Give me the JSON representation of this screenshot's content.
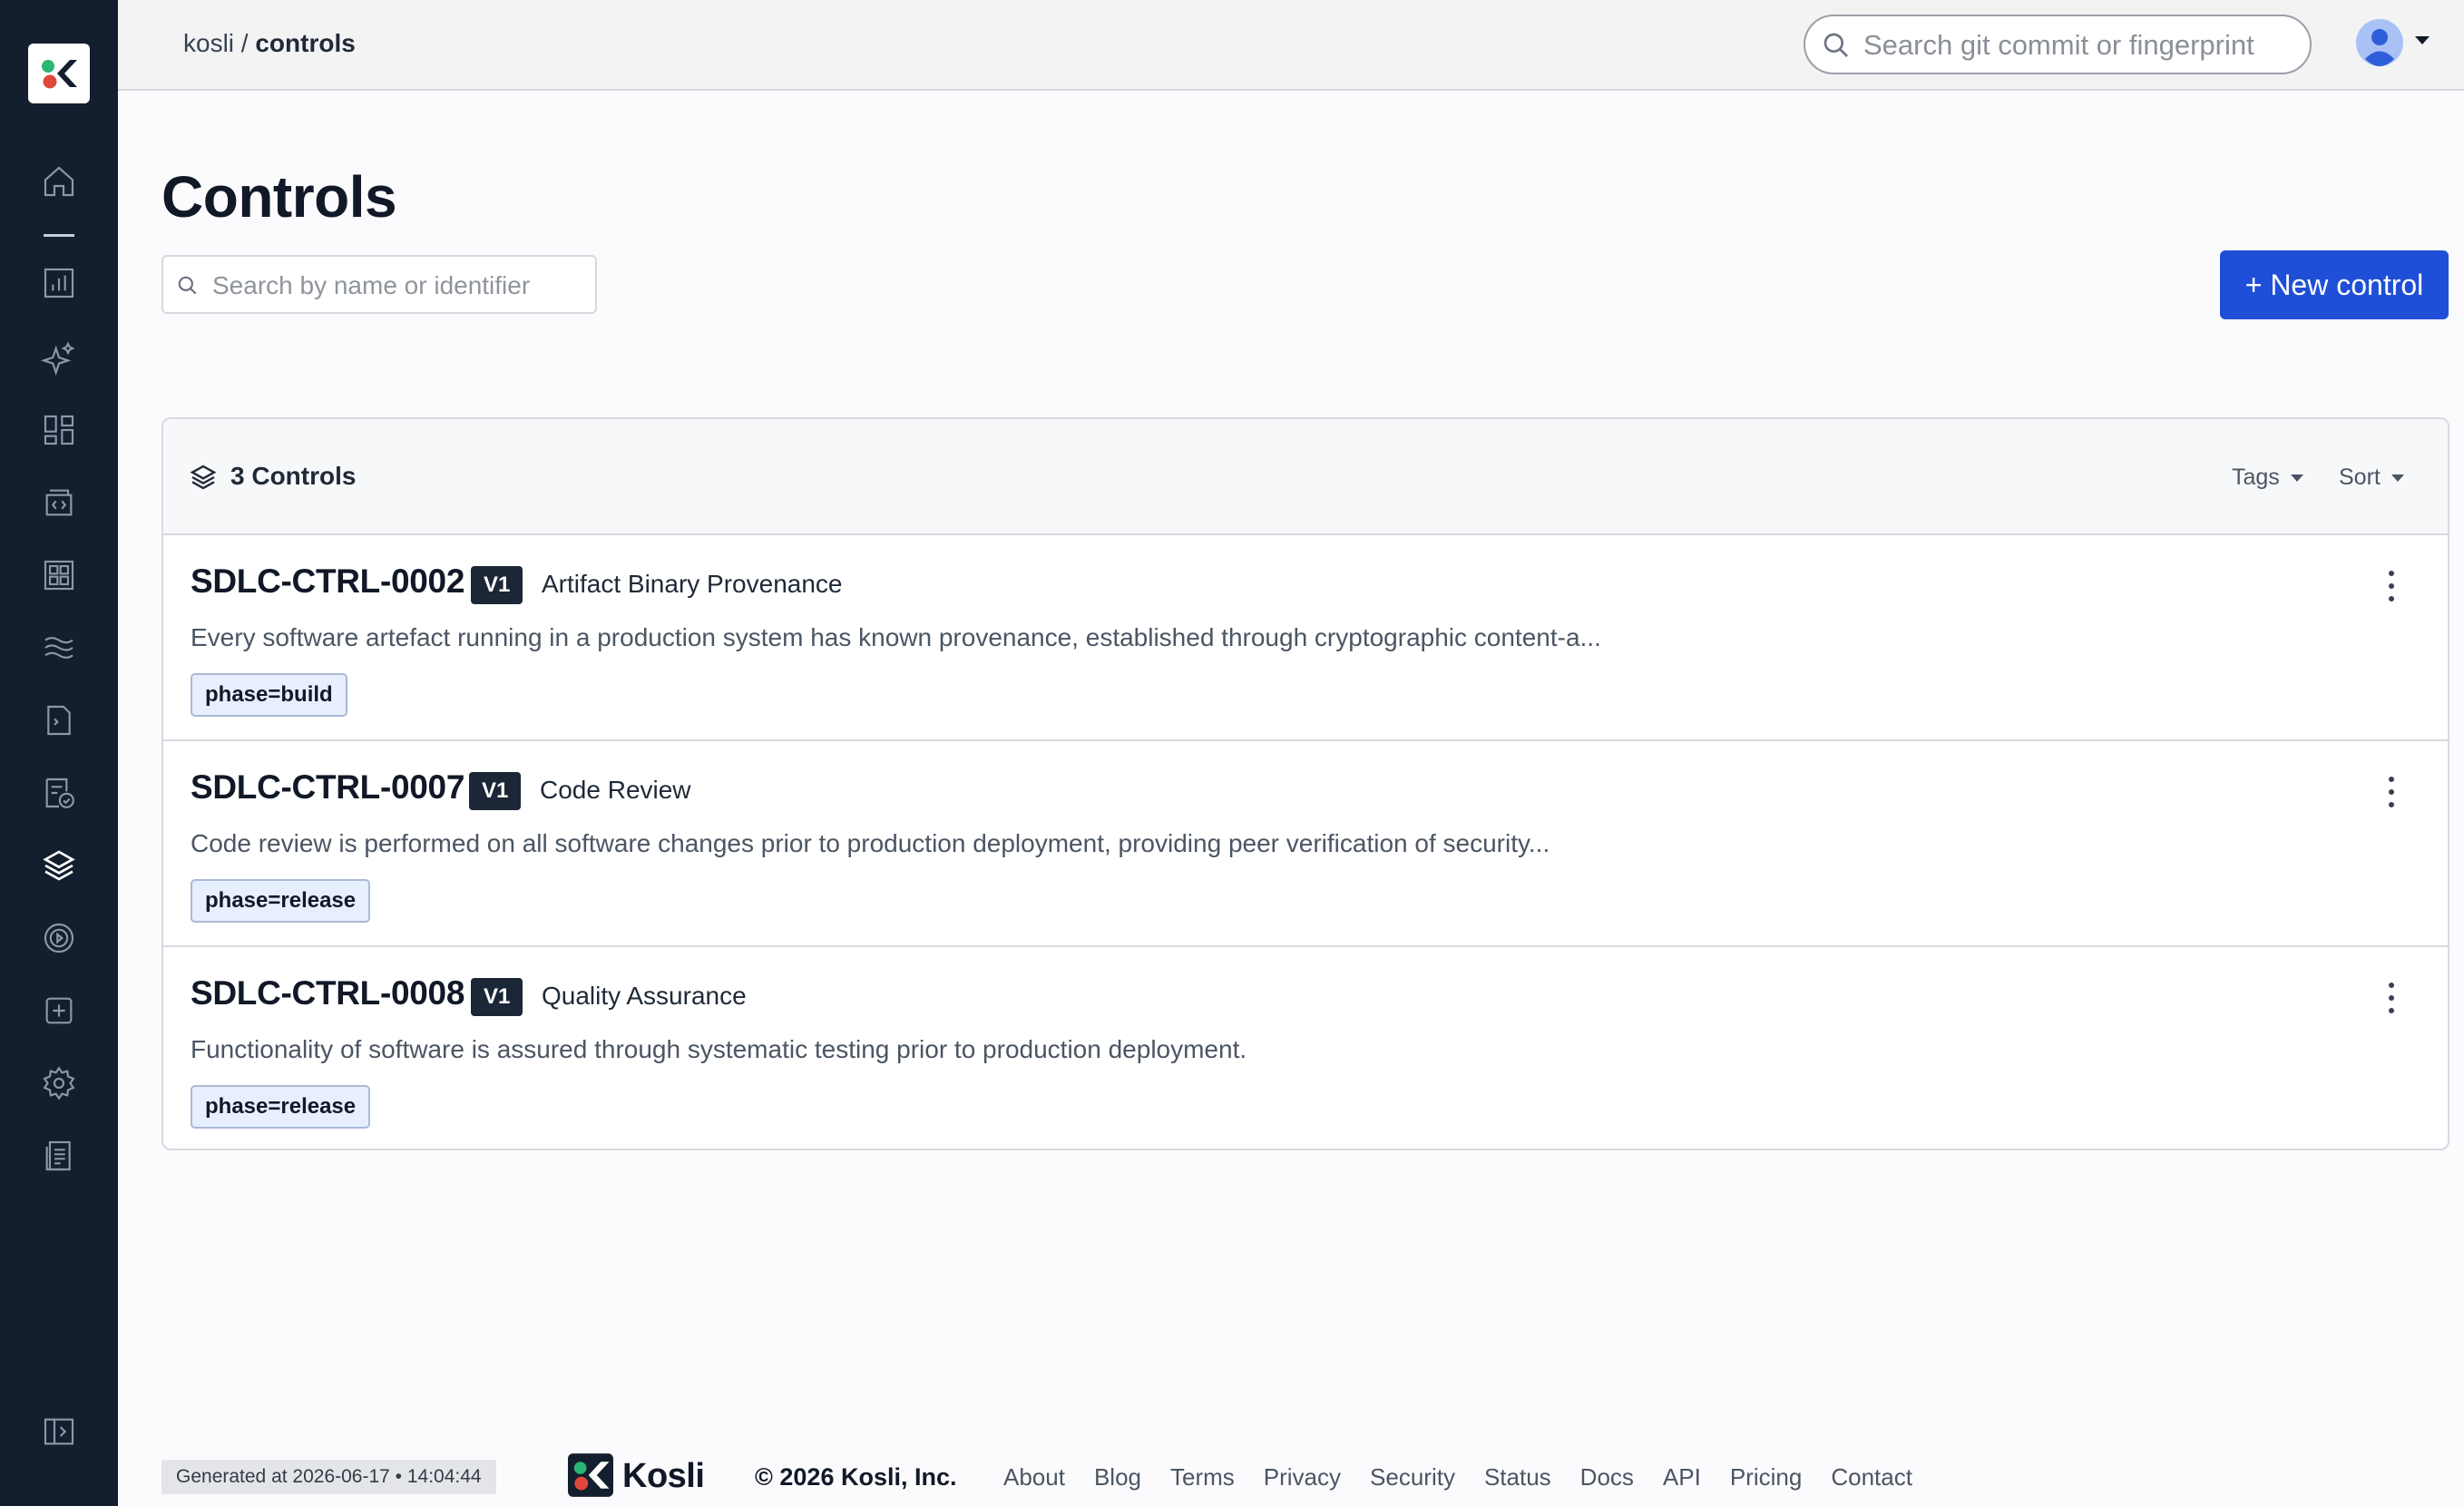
{
  "breadcrumb": {
    "org": "kosli",
    "separator": " / ",
    "current": "controls"
  },
  "global_search": {
    "placeholder": "Search git commit or fingerprint"
  },
  "page": {
    "title": "Controls",
    "search_placeholder": "Search by name or identifier",
    "new_button_label": "+ New control"
  },
  "panel": {
    "count_label": "3 Controls",
    "tags_label": "Tags",
    "sort_label": "Sort"
  },
  "controls": [
    {
      "id": "SDLC-CTRL-0002",
      "version": "V1",
      "name": "Artifact Binary Provenance",
      "description": "Every software artefact running in a production system has known provenance, established through cryptographic content-a...",
      "tag": "phase=build"
    },
    {
      "id": "SDLC-CTRL-0007",
      "version": "V1",
      "name": "Code Review",
      "description": "Code review is performed on all software changes prior to production deployment, providing peer verification of security...",
      "tag": "phase=release"
    },
    {
      "id": "SDLC-CTRL-0008",
      "version": "V1",
      "name": "Quality Assurance",
      "description": "Functionality of software is assured through systematic testing prior to production deployment.",
      "tag": "phase=release"
    }
  ],
  "footer": {
    "generated": "Generated at 2026-06-17 • 14:04:44",
    "brand": "Kosli",
    "copyright": "© 2026 Kosli, Inc.",
    "links": [
      "About",
      "Blog",
      "Terms",
      "Privacy",
      "Security",
      "Status",
      "Docs",
      "API",
      "Pricing",
      "Contact"
    ]
  },
  "sidebar_icons": [
    "home-icon",
    "bar-chart-icon",
    "sparkle-icon",
    "dashboard-icon",
    "code-box-icon",
    "grid-icon",
    "waves-icon",
    "terminal-file-icon",
    "checklist-icon",
    "layers-icon",
    "target-icon",
    "plus-box-icon",
    "gear-icon",
    "document-icon",
    "collapse-sidebar-icon"
  ],
  "colors": {
    "sidebar_bg": "#131e2e",
    "primary_button": "#1f4fd6",
    "version_badge": "#1b2636",
    "tag_bg": "#e7efff",
    "logo_green": "#2bb673",
    "logo_red": "#e0483c"
  }
}
